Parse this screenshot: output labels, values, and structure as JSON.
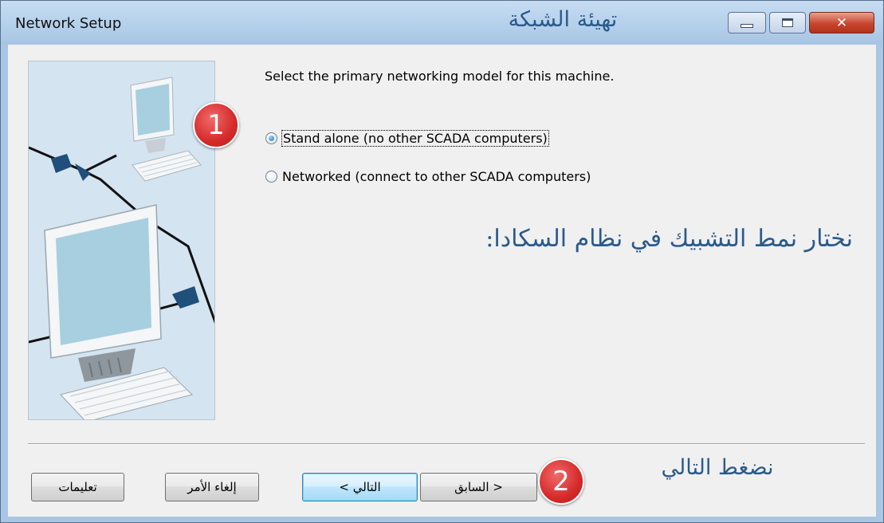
{
  "window": {
    "title": "Network Setup",
    "title_annotation_ar": "تهيئة الشبكة",
    "controls": {
      "minimize_icon": "minimize-icon",
      "maximize_icon": "maximize-icon",
      "close_glyph": "✕"
    }
  },
  "content": {
    "prompt": "Select the primary networking model for this machine.",
    "options": [
      {
        "label": "Stand alone (no other SCADA computers)",
        "selected": true
      },
      {
        "label": "Networked (connect to other SCADA computers)",
        "selected": false
      }
    ],
    "annotation_ar": "نختار نمط التشبيك في نظام السكادا:",
    "next_annotation_ar": "نضغط التالي"
  },
  "buttons": {
    "help": "تعليمات",
    "cancel": "إلغاء الأمر",
    "next": "التالي >",
    "back": "< السابق"
  },
  "badges": {
    "one": "1",
    "two": "2"
  },
  "colors": {
    "annotation": "#2a5a8c",
    "badge": "#d52a2a",
    "illustration_bg": "#d4e4f0"
  }
}
